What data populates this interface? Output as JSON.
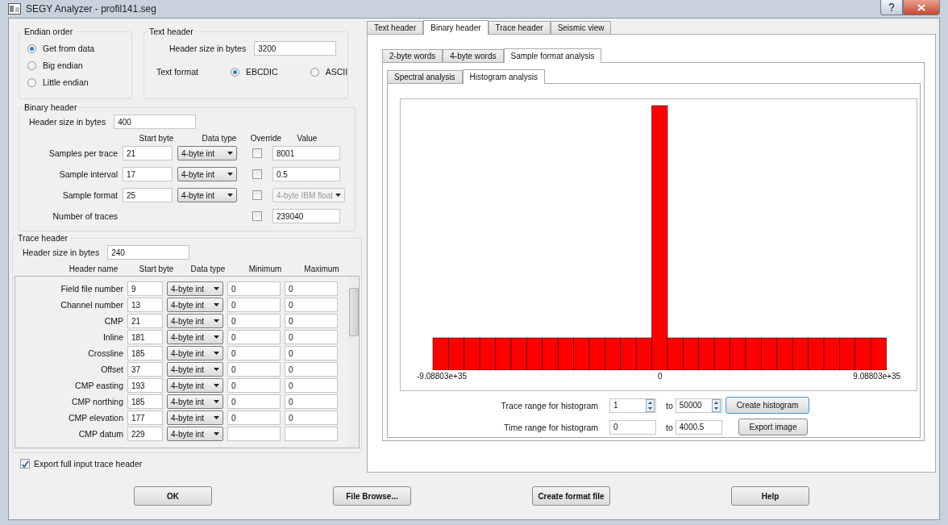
{
  "window": {
    "title": "SEGY Analyzer  -  profil141.seg"
  },
  "endian_order": {
    "title": "Endian order",
    "options": [
      {
        "label": "Get from data",
        "selected": true
      },
      {
        "label": "Big endian",
        "selected": false
      },
      {
        "label": "Little endian",
        "selected": false
      }
    ]
  },
  "text_header": {
    "title": "Text header",
    "size_label": "Header size in bytes",
    "size_value": "3200",
    "format_label": "Text format",
    "formats": [
      {
        "label": "EBCDIC",
        "selected": true
      },
      {
        "label": "ASCII",
        "selected": false
      }
    ]
  },
  "binary_header": {
    "title": "Binary header",
    "size_label": "Header size in bytes",
    "size_value": "400",
    "columns": [
      "Start byte",
      "Data type",
      "Override",
      "Value"
    ],
    "rows": [
      {
        "name": "Samples per trace",
        "start_byte": "21",
        "data_type": "4-byte int",
        "override": false,
        "kind": "field",
        "value": "8001"
      },
      {
        "name": "Sample interval",
        "start_byte": "17",
        "data_type": "4-byte int",
        "override": false,
        "kind": "field",
        "value": "0.5"
      },
      {
        "name": "Sample format",
        "start_byte": "25",
        "data_type": "4-byte int",
        "override": false,
        "kind": "dropdown",
        "value": "4-byte IBM float"
      },
      {
        "name": "Number of traces",
        "override": false,
        "kind": "field",
        "value": "239040"
      }
    ]
  },
  "trace_header": {
    "title": "Trace header",
    "size_label": "Header size in bytes",
    "size_value": "240",
    "columns": [
      "Header name",
      "Start byte",
      "Data type",
      "Minimum",
      "Maximum"
    ],
    "rows": [
      {
        "name": "Field file number",
        "start_byte": "9",
        "data_type": "4-byte int",
        "minimum": "0",
        "maximum": "0"
      },
      {
        "name": "Channel number",
        "start_byte": "13",
        "data_type": "4-byte int",
        "minimum": "0",
        "maximum": "0"
      },
      {
        "name": "CMP",
        "start_byte": "21",
        "data_type": "4-byte int",
        "minimum": "0",
        "maximum": "0"
      },
      {
        "name": "Inline",
        "start_byte": "181",
        "data_type": "4-byte int",
        "minimum": "0",
        "maximum": "0"
      },
      {
        "name": "Crossline",
        "start_byte": "185",
        "data_type": "4-byte int",
        "minimum": "0",
        "maximum": "0"
      },
      {
        "name": "Offset",
        "start_byte": "37",
        "data_type": "4-byte int",
        "minimum": "0",
        "maximum": "0"
      },
      {
        "name": "CMP easting",
        "start_byte": "193",
        "data_type": "4-byte int",
        "minimum": "0",
        "maximum": "0"
      },
      {
        "name": "CMP  northing",
        "start_byte": "185",
        "data_type": "4-byte int",
        "minimum": "0",
        "maximum": "0"
      },
      {
        "name": "CMP  elevation",
        "start_byte": "177",
        "data_type": "4-byte int",
        "minimum": "0",
        "maximum": "0"
      },
      {
        "name": "CMP  datum",
        "start_byte": "229",
        "data_type": "4-byte int"
      }
    ]
  },
  "export_full_header": {
    "label": "Export full input trace header",
    "checked": true
  },
  "buttons": [
    "OK",
    "File Browse...",
    "Create format file",
    "Help"
  ],
  "main_tabs": [
    {
      "label": "Text header",
      "selected": false
    },
    {
      "label": "Binary header",
      "selected": true
    },
    {
      "label": "Trace header",
      "selected": false
    },
    {
      "label": "Seismic view",
      "selected": false
    }
  ],
  "sub_tabs": [
    {
      "label": "2-byte words",
      "selected": false
    },
    {
      "label": "4-byte words",
      "selected": false
    },
    {
      "label": "Sample format analysis",
      "selected": true
    }
  ],
  "analysis_tabs": [
    {
      "label": "Spectral analysis",
      "selected": false
    },
    {
      "label": "Histogram analysis",
      "selected": true
    }
  ],
  "histogram": {
    "x_labels": [
      "-9.08803e+35",
      "0",
      "9.08803e+35"
    ]
  },
  "trace_range": {
    "label": "Trace range for histogram",
    "from": "1",
    "to_label": "to",
    "to": "50000",
    "button": "Create histogram"
  },
  "time_range": {
    "label": "Time range for histogram",
    "from": "0",
    "to_label": "to",
    "to": "4000.5",
    "button": "Export image"
  }
}
